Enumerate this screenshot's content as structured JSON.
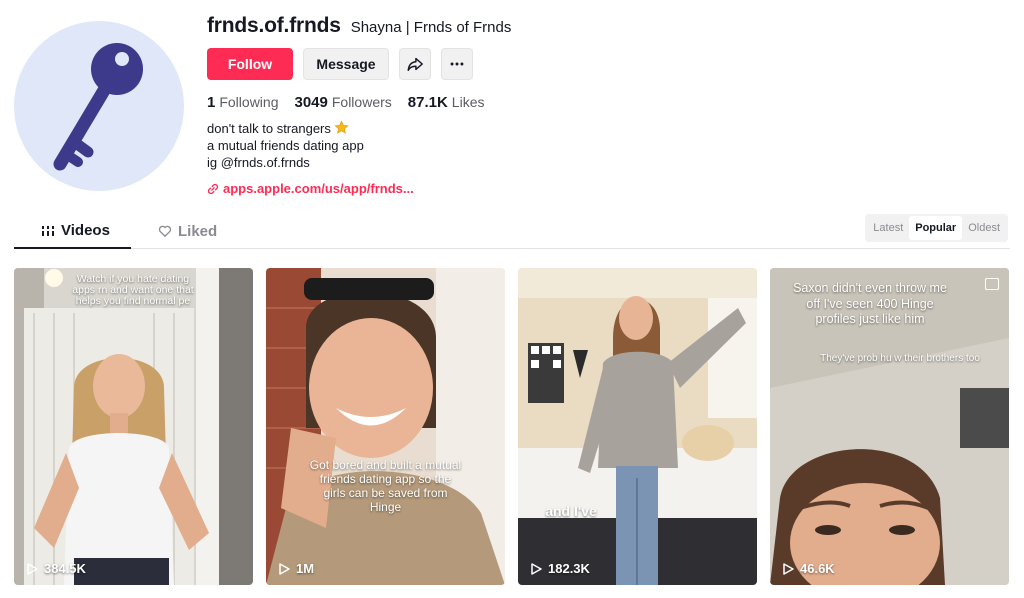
{
  "profile": {
    "username": "frnds.of.frnds",
    "nickname": "Shayna | Frnds of Frnds",
    "follow_label": "Follow",
    "message_label": "Message",
    "stats": {
      "following_count": "1",
      "following_label": "Following",
      "followers_count": "3049",
      "followers_label": "Followers",
      "likes_count": "87.1K",
      "likes_label": "Likes"
    },
    "bio_lines": [
      "don't talk to strangers",
      "a mutual friends dating app",
      "ig @frnds.of.frnds"
    ],
    "link": "apps.apple.com/us/app/frnds..."
  },
  "tabs": {
    "videos": "Videos",
    "liked": "Liked"
  },
  "sort": {
    "latest": "Latest",
    "popular": "Popular",
    "oldest": "Oldest"
  },
  "videos": [
    {
      "overlay": "Watch if you hate dating apps rn and want one that helps you find normal pe",
      "views": "384.5K"
    },
    {
      "overlay": "Got bored and built a mutual friends dating app so the girls can be saved from Hinge",
      "views": "1M"
    },
    {
      "overlay": "and I've",
      "views": "182.3K"
    },
    {
      "overlay": "Saxon didn't even throw me off I've seen 400 Hinge profiles just like him",
      "overlay2": "They've prob hu w their brothers too",
      "views": "46.6K"
    }
  ],
  "colors": {
    "accent": "#fe2c55",
    "avatar_bg": "#dfe7f8",
    "key": "#3d3a8c"
  },
  "icons": [
    "key-icon",
    "share-icon",
    "more-icon",
    "star-icon",
    "link-icon",
    "grid-icon",
    "heart-icon",
    "play-icon",
    "image-icon"
  ]
}
